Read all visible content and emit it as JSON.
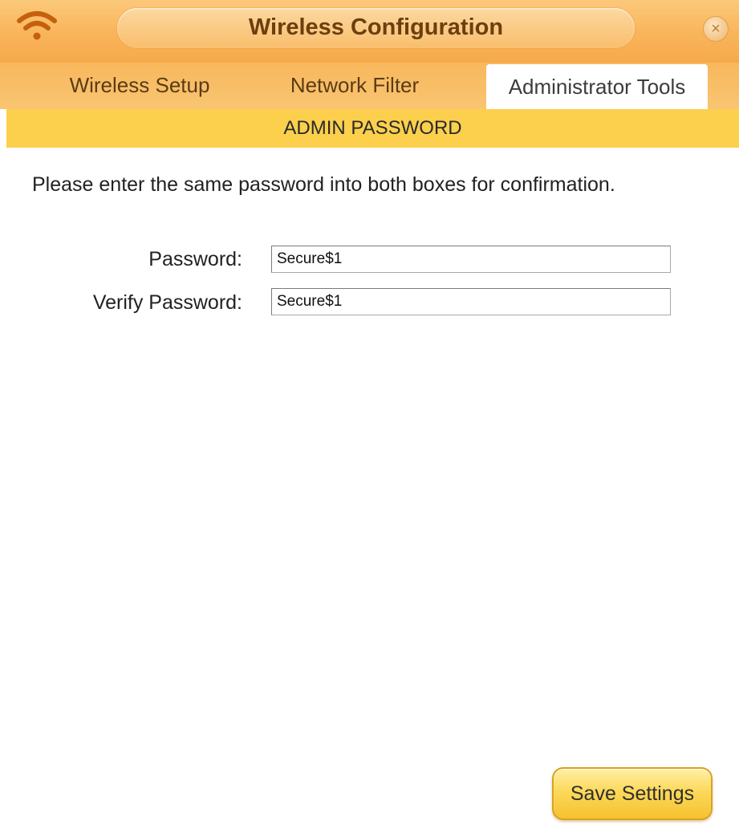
{
  "window": {
    "title": "Wireless Configuration",
    "close_symbol": "×",
    "icon": "wifi-icon"
  },
  "tabs": [
    {
      "label": "Wireless Setup",
      "active": false
    },
    {
      "label": "Network Filter",
      "active": false
    },
    {
      "label": "Administrator Tools",
      "active": true
    }
  ],
  "section": {
    "title": "ADMIN PASSWORD",
    "instructions": "Please enter the same password into both boxes for confirmation."
  },
  "form": {
    "password_label": "Password:",
    "password_value": "Secure$1",
    "verify_label": "Verify Password:",
    "verify_value": "Secure$1"
  },
  "actions": {
    "save_label": "Save Settings"
  },
  "colors": {
    "titlebar": "#f9b45a",
    "section_header": "#fcd04d",
    "save_button": "#fcd95a",
    "title_text": "#6b3f0e"
  }
}
